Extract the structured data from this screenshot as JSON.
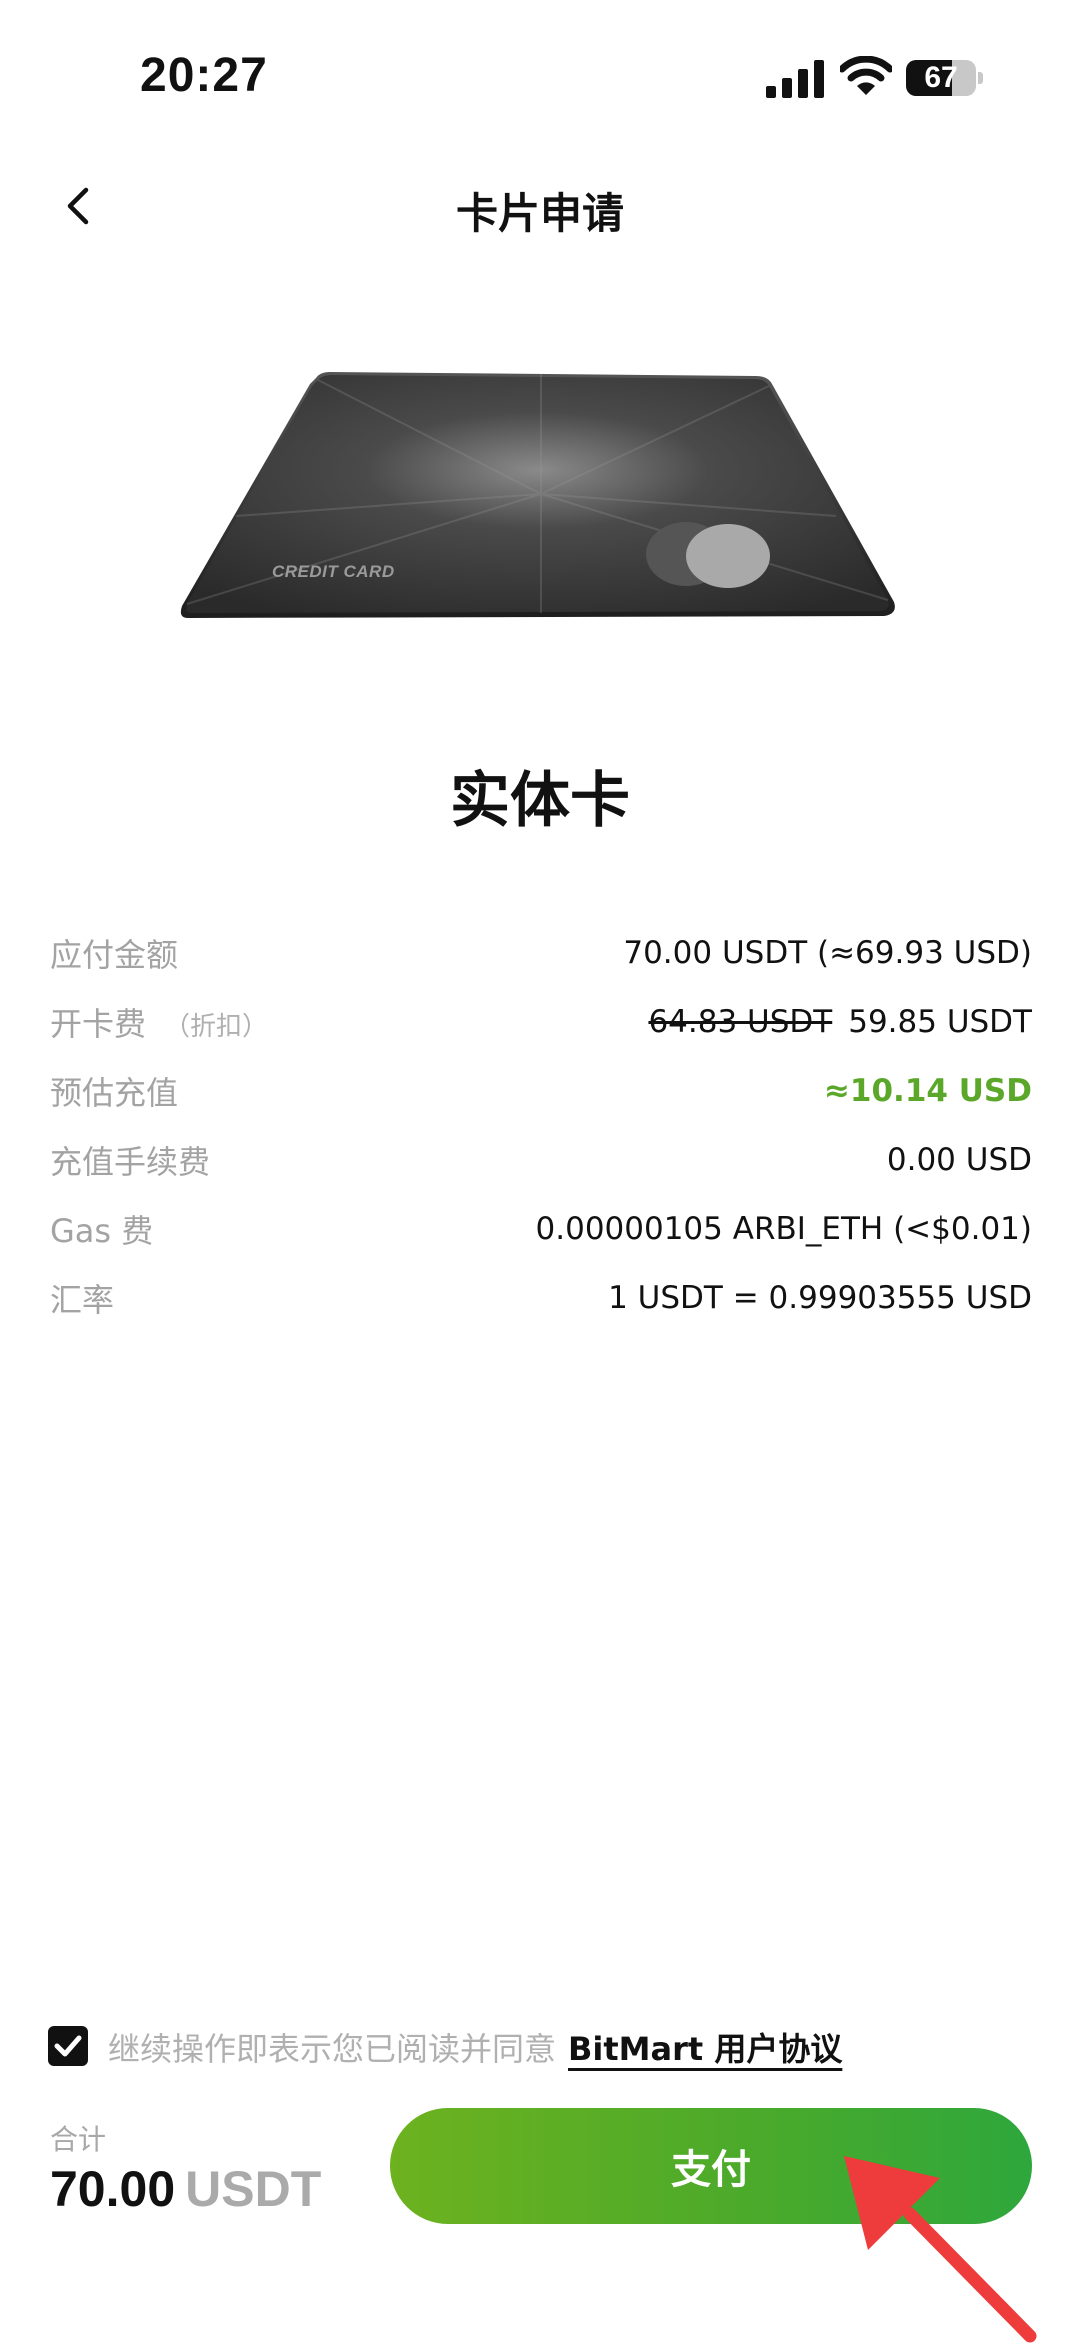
{
  "status_bar": {
    "time": "20:27",
    "battery": "67",
    "icons": [
      "signal-icon",
      "wifi-icon",
      "battery-icon"
    ]
  },
  "header": {
    "title": "卡片申请",
    "back_icon": "chevron-left-icon"
  },
  "card": {
    "label": "CREDIT CARD",
    "type_title": "实体卡"
  },
  "details": {
    "amount_due": {
      "label": "应付金额",
      "value": "70.00 USDT (≈69.93 USD)"
    },
    "card_fee": {
      "label": "开卡费",
      "sublabel": "（折扣）",
      "original": "64.83 USDT",
      "value": "59.85 USDT"
    },
    "estimated_topup": {
      "label": "预估充值",
      "value": "≈10.14 USD"
    },
    "topup_fee": {
      "label": "充值手续费",
      "value": "0.00 USD"
    },
    "gas_fee": {
      "label": "Gas 费",
      "value": "0.00000105 ARBI_ETH (<$0.01)"
    },
    "exchange_rate": {
      "label": "汇率",
      "value": "1 USDT = 0.99903555 USD"
    }
  },
  "agreement": {
    "checked": true,
    "text": "继续操作即表示您已阅读并同意",
    "link": "BitMart 用户协议"
  },
  "footer": {
    "total_label": "合计",
    "total_amount": "70.00",
    "total_currency": "USDT",
    "pay_label": "支付"
  },
  "colors": {
    "accent_green": "#4caa2a",
    "value_green": "#5aa72a",
    "annotation_red": "#ee3b3b"
  }
}
